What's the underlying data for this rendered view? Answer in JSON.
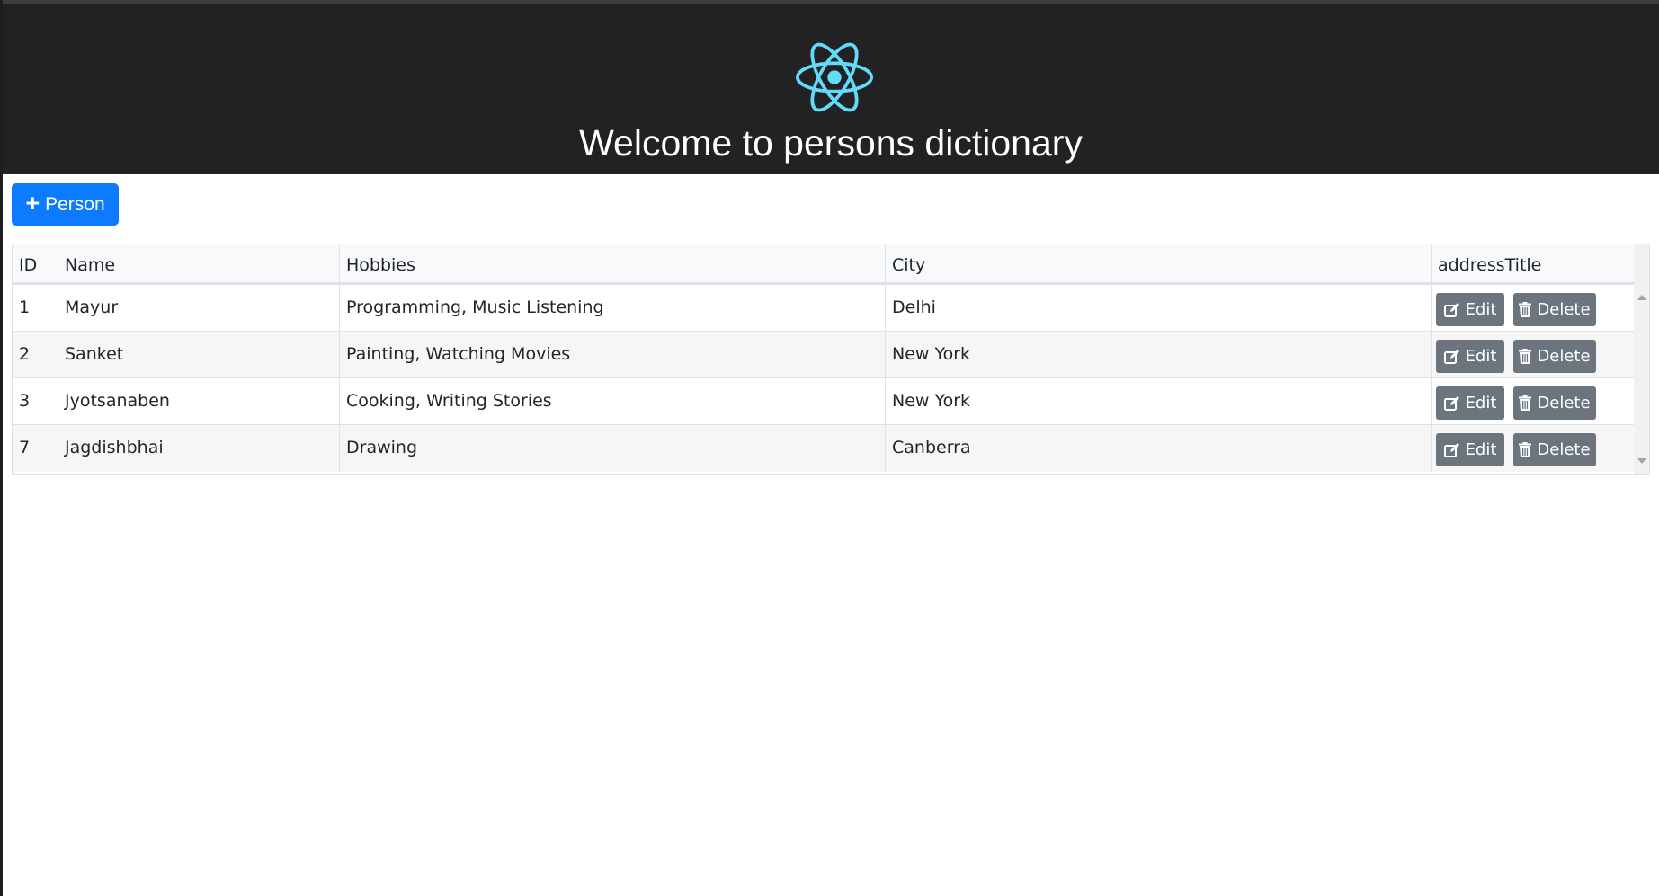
{
  "header": {
    "title": "Welcome to persons dictionary",
    "logo_icon": "react-atom-icon",
    "logo_color": "#61dafb",
    "background": "#222222"
  },
  "toolbar": {
    "add_label": "Person",
    "add_icon": "plus-icon",
    "add_color": "#0d7bff"
  },
  "table": {
    "columns": [
      "ID",
      "Name",
      "Hobbies",
      "City",
      "addressTitle"
    ],
    "rows": [
      {
        "id": "1",
        "name": "Mayur",
        "hobbies": "Programming, Music Listening",
        "city": "Delhi"
      },
      {
        "id": "2",
        "name": "Sanket",
        "hobbies": "Painting, Watching Movies",
        "city": "New York"
      },
      {
        "id": "3",
        "name": "Jyotsanaben",
        "hobbies": "Cooking, Writing Stories",
        "city": "New York"
      },
      {
        "id": "7",
        "name": "Jagdishbhai",
        "hobbies": "Drawing",
        "city": "Canberra"
      }
    ],
    "actions": {
      "edit_label": "Edit",
      "edit_icon": "edit-icon",
      "delete_label": "Delete",
      "delete_icon": "trash-icon",
      "button_color": "#6c757d"
    }
  }
}
